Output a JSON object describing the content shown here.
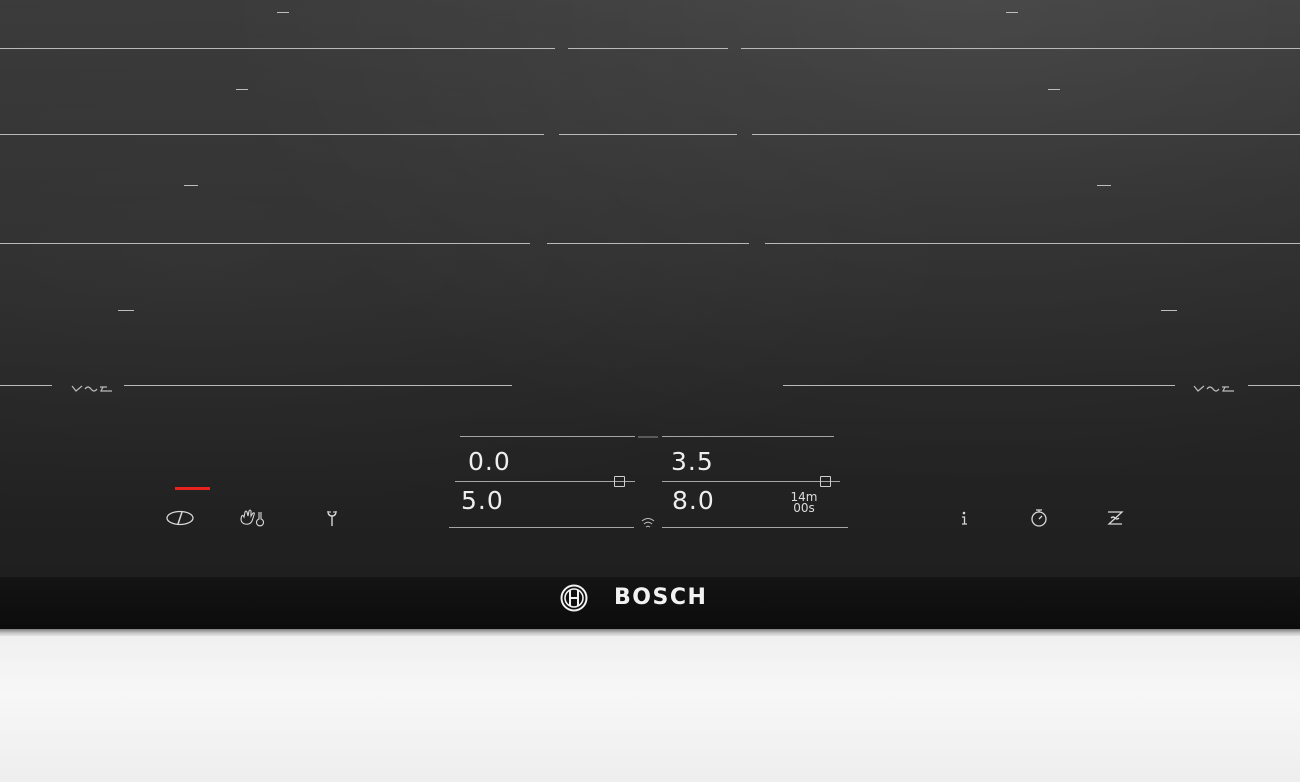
{
  "brand": {
    "name": "BOSCH",
    "logo_icon": "bosch-armature-logo-icon"
  },
  "colors": {
    "glass": "#2b2b2b",
    "zone_line": "#b9b9b9",
    "active_indicator": "#e8231f",
    "counter": "#f2f2f2"
  },
  "display": {
    "left_top_value": "0.0",
    "left_bottom_value": "5.0",
    "right_top_value": "3.5",
    "right_bottom_value": "8.0",
    "timer_minutes": "14m",
    "timer_seconds": "00s",
    "wifi_icon": "wifi-icon"
  },
  "controls_left": [
    {
      "name": "power-icon",
      "label": "on/off"
    },
    {
      "name": "child-lock-icon",
      "label": "child lock / wipe protection"
    },
    {
      "name": "settings-wrench-icon",
      "label": "basic settings"
    }
  ],
  "controls_right": [
    {
      "name": "info-icon",
      "label": "info"
    },
    {
      "name": "stopwatch-icon",
      "label": "timer"
    },
    {
      "name": "hood-connect-icon",
      "label": "hood control"
    }
  ],
  "power_indicator": {
    "state": "on"
  },
  "zone_symbols": [
    "flex-zone-icon",
    "flex-zone-icon"
  ]
}
